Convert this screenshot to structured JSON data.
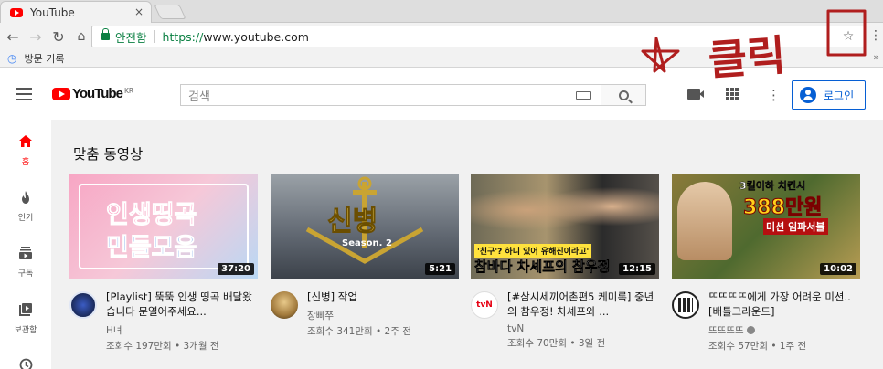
{
  "browser": {
    "tab_title": "YouTube",
    "tab_close": "×",
    "secure_label": "안전함",
    "url_scheme": "https://",
    "url_host": "www.youtube.com",
    "bookmark_item": "방문 기록",
    "bookmark_more": "»"
  },
  "annotation": {
    "text": "클릭",
    "color": "#b01e1e"
  },
  "yt": {
    "logo_word": "YouTube",
    "country": "KR",
    "search_placeholder": "검색",
    "login_label": "로그인",
    "accent": "#065fd4",
    "brand": "#ff0000"
  },
  "sidebar": {
    "items": [
      {
        "label": "홈",
        "icon": "home-icon"
      },
      {
        "label": "인기",
        "icon": "fire-icon"
      },
      {
        "label": "구독",
        "icon": "subscriptions-icon"
      },
      {
        "label": "보관함",
        "icon": "library-icon"
      },
      {
        "label": "",
        "icon": "history-icon"
      }
    ]
  },
  "feed": {
    "section_title": "맞춤 동영상",
    "videos": [
      {
        "title": "[Playlist] 뚝뚝 인생 띵곡 배달왔습니다 문열어주세요...",
        "channel": "H녀",
        "stats": "조회수 197만회 • 3개월 전",
        "duration": "37:20",
        "thumb_text_1": "인생띵곡",
        "thumb_text_2": "민들모음"
      },
      {
        "title": "[신병] 작업",
        "channel": "장삐쭈",
        "stats": "조회수 341만회 • 2주 전",
        "duration": "5:21",
        "thumb_text_1": "신병",
        "thumb_text_2": "Season. 2"
      },
      {
        "title": "[#삼시세끼어촌편5 케미록] 중년의 참우정! 차셰프와 ...",
        "channel": "tvN",
        "stats": "조회수 70만회 • 3일 전",
        "duration": "12:15",
        "thumb_text_1": "참바다 차셰프의 참우정",
        "thumb_text_2": "'친구'? 하니 있어 유해진이라고'",
        "channel_avatar_text": "tvN"
      },
      {
        "title": "뜨뜨뜨뜨에게 가장 어려운 미션.. [배틀그라운드]",
        "channel": "뜨뜨뜨뜨",
        "stats": "조회수 57만회 • 1주 전",
        "duration": "10:02",
        "thumb_text_1": "388만원",
        "thumb_text_2": "3킬이하 치킨시",
        "thumb_text_3": "미션 임파서블"
      }
    ]
  }
}
